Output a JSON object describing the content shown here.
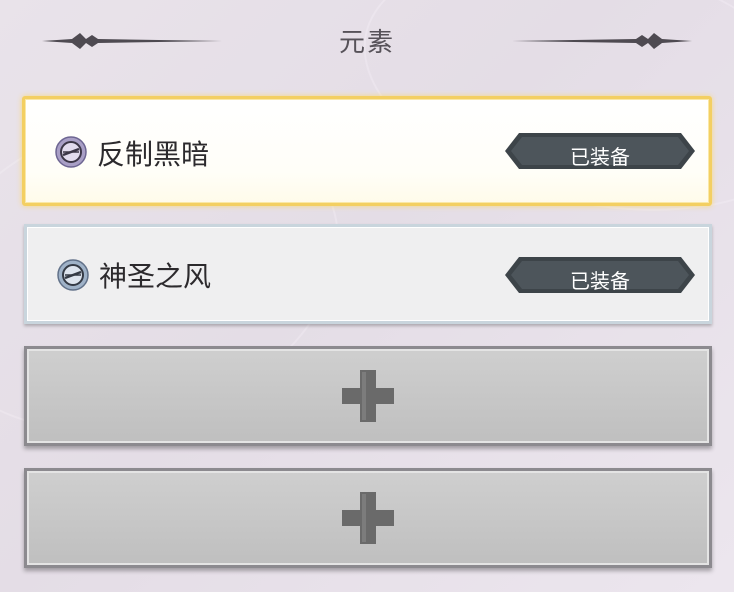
{
  "header": {
    "title": "元素"
  },
  "slots": [
    {
      "name": "反制黑暗",
      "status": "已装备",
      "icon": "shield-slash-icon",
      "frame": "gold"
    },
    {
      "name": "神圣之风",
      "status": "已装备",
      "icon": "shield-slash-icon",
      "frame": "silver"
    },
    {
      "icon": "plus-icon",
      "frame": "empty"
    },
    {
      "icon": "plus-icon",
      "frame": "empty"
    }
  ],
  "colors": {
    "gold_border": "#f3cf62",
    "silver_border": "#c9d5dd",
    "badge_bg": "#3d4449",
    "empty_slot": "#c5c5c5",
    "plus": "#6a6a6a"
  }
}
